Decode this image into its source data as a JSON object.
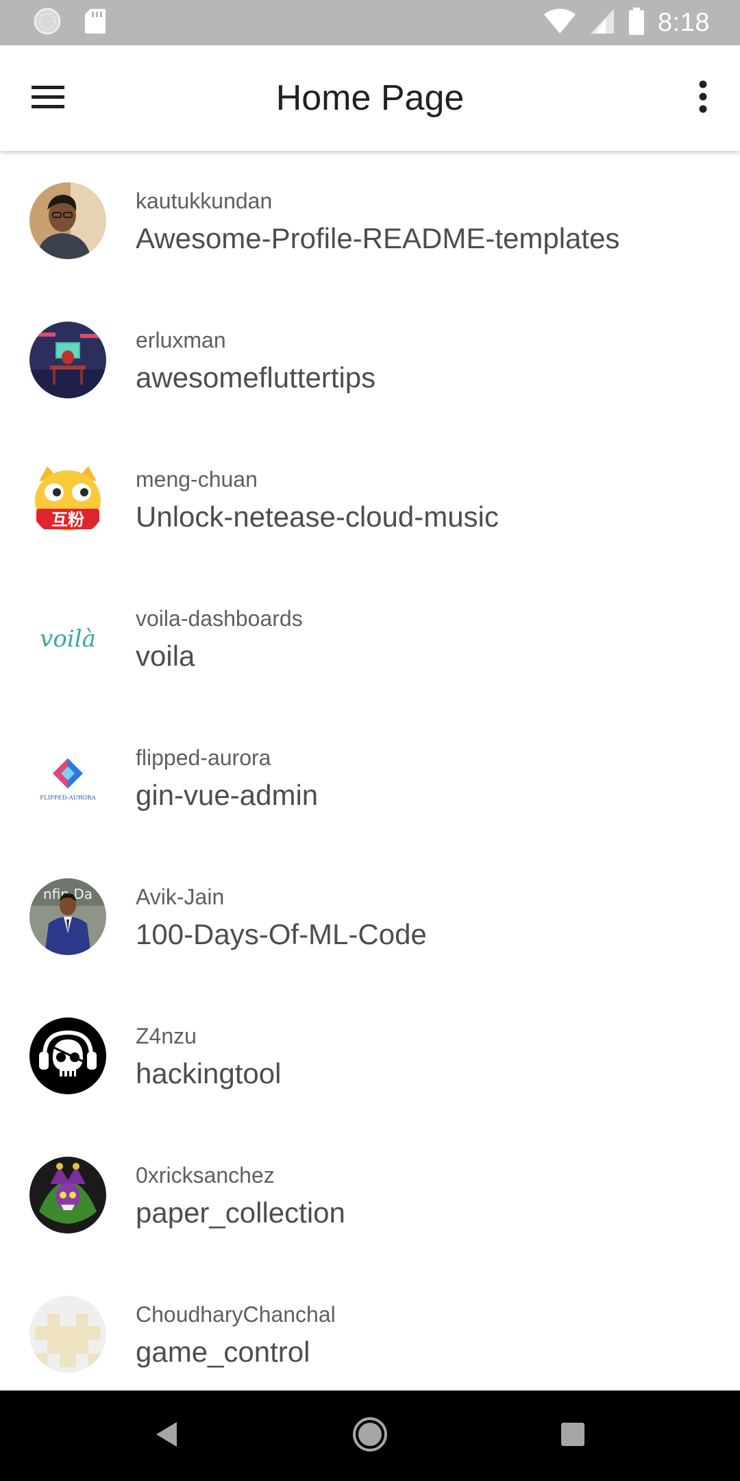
{
  "status_bar": {
    "time": "8:18",
    "icons": [
      "sync-icon",
      "sd-card-icon",
      "wifi-icon",
      "cell-signal-icon",
      "battery-icon"
    ]
  },
  "app_bar": {
    "title": "Home Page",
    "left_icon": "hamburger-menu-icon",
    "right_icon": "more-vert-icon"
  },
  "repos": [
    {
      "owner": "kautukkundan",
      "name": "Awesome-Profile-README-templates",
      "avatar": "portrait-avatar"
    },
    {
      "owner": "erluxman",
      "name": "awesomefluttertips",
      "avatar": "desk-scene-avatar"
    },
    {
      "owner": "meng-chuan",
      "name": "Unlock-netease-cloud-music",
      "avatar": "emoji-dog-avatar",
      "avatar_text": "互粉"
    },
    {
      "owner": "voila-dashboards",
      "name": "voila",
      "avatar": "voila-logo-avatar",
      "avatar_text": "voilà"
    },
    {
      "owner": "flipped-aurora",
      "name": "gin-vue-admin",
      "avatar": "flipped-aurora-logo-avatar",
      "avatar_text": "FLIPPED-AURORA"
    },
    {
      "owner": "Avik-Jain",
      "name": "100-Days-Of-ML-Code",
      "avatar": "suit-portrait-avatar",
      "avatar_text": "nfin Da"
    },
    {
      "owner": "Z4nzu",
      "name": "hackingtool",
      "avatar": "pirate-skull-avatar"
    },
    {
      "owner": "0xricksanchez",
      "name": "paper_collection",
      "avatar": "jester-skull-avatar"
    },
    {
      "owner": "ChoudharyChanchal",
      "name": "game_control",
      "avatar": "identicon-avatar"
    }
  ],
  "nav_bar": {
    "buttons": [
      "back-icon",
      "home-icon",
      "recents-icon"
    ]
  },
  "colors": {
    "status_bar": "#b7b7b7",
    "app_bar": "#ffffff",
    "title_text": "#212121",
    "owner_text": "#5f5f5f",
    "repo_text": "#4d4d4d",
    "nav_bar": "#000000"
  }
}
